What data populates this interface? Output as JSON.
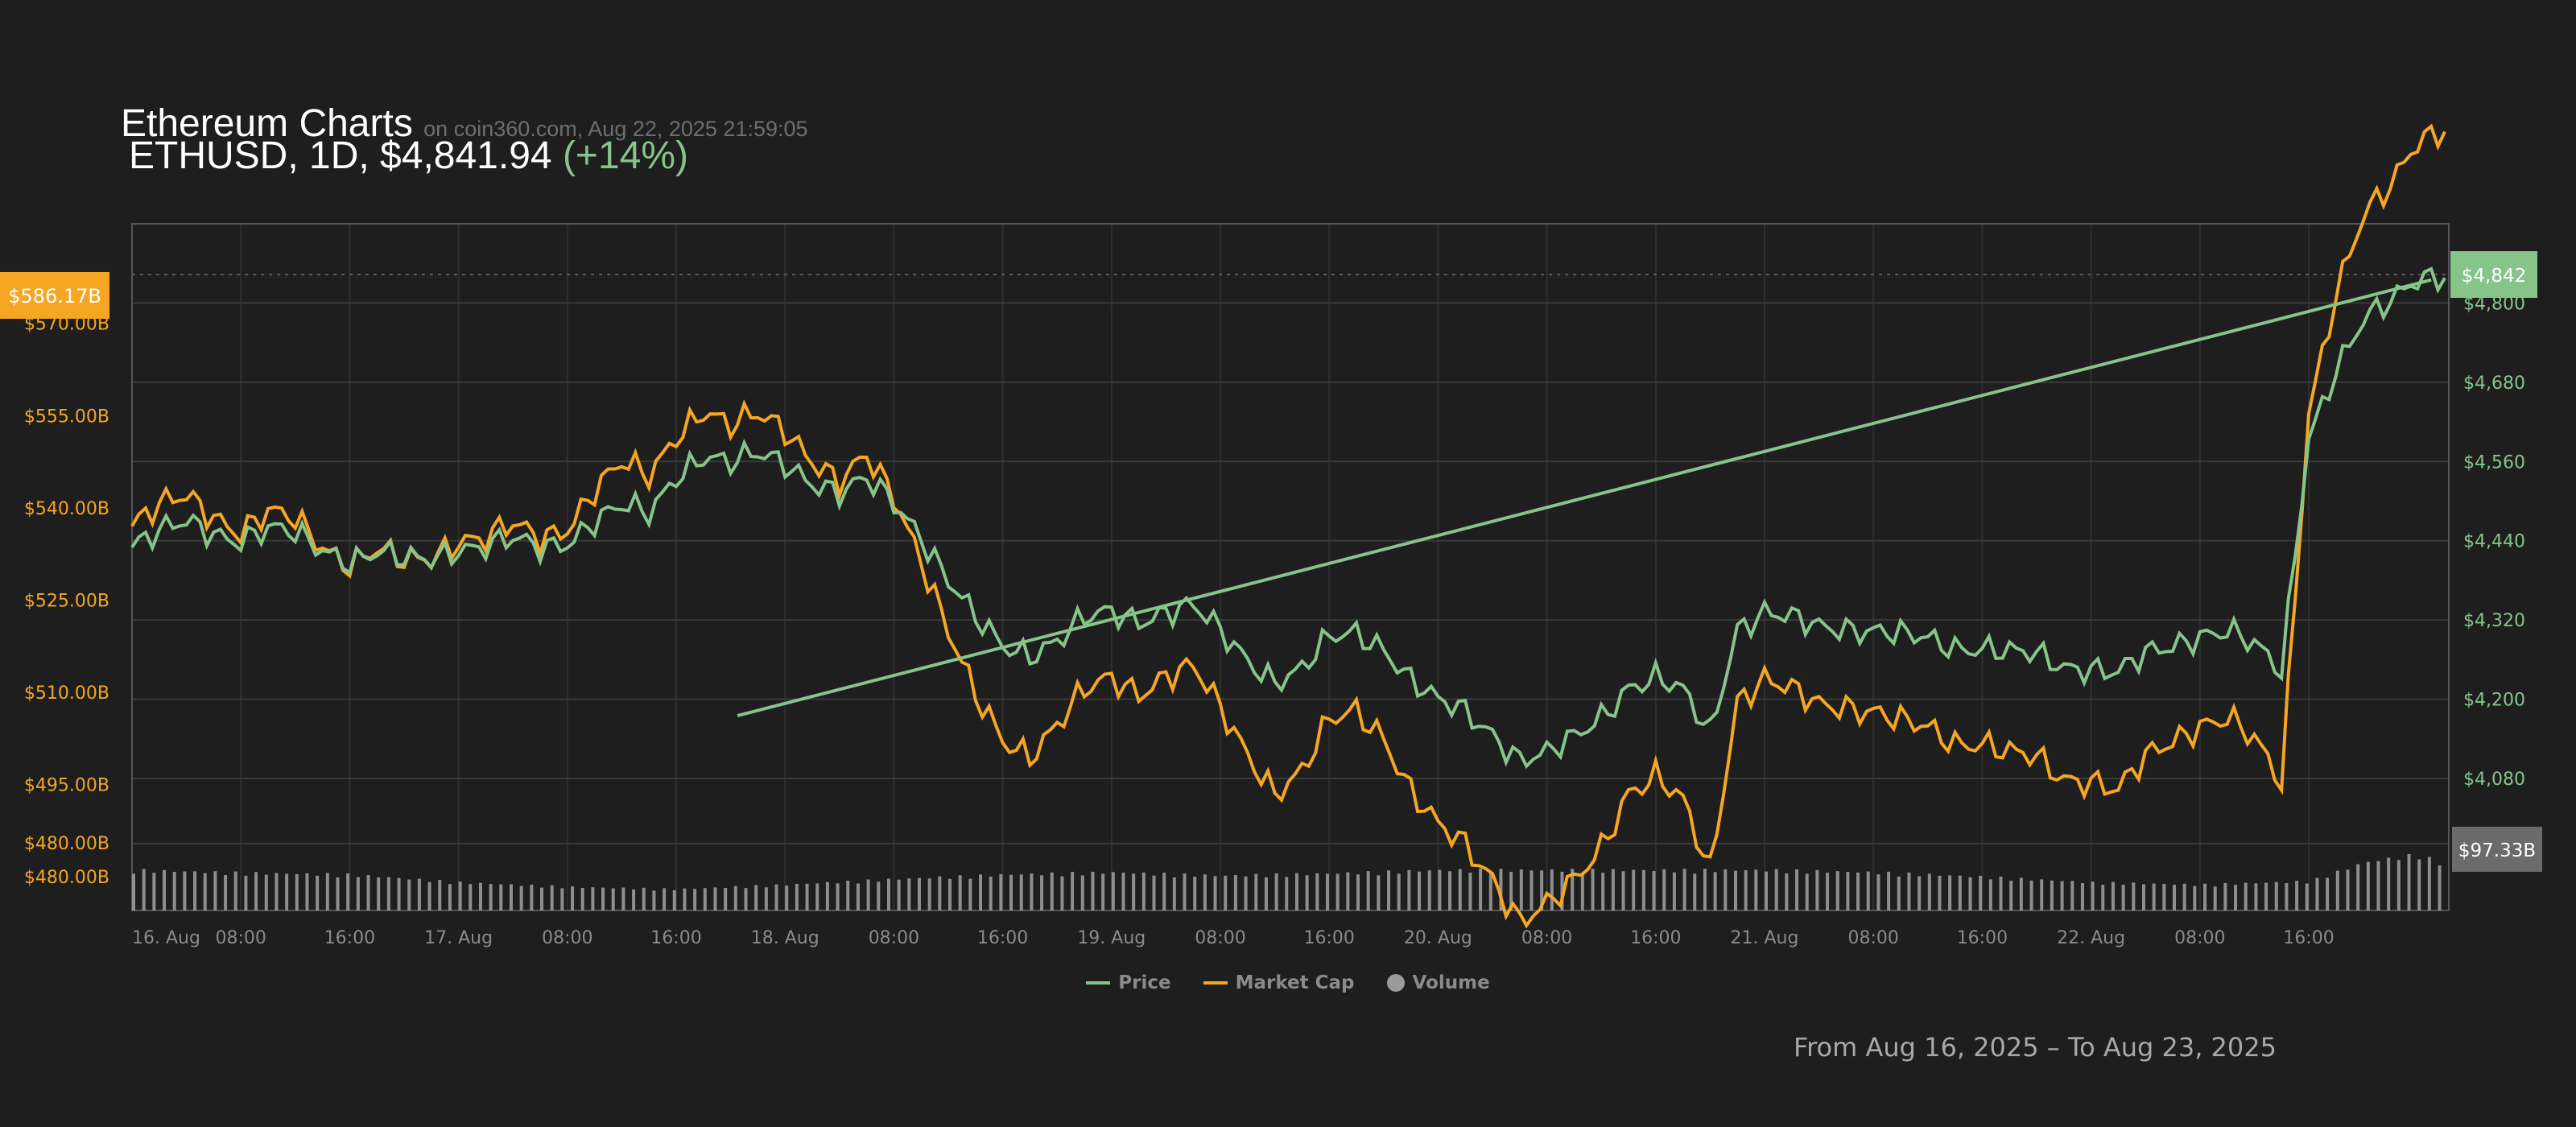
{
  "header": {
    "title": "Ethereum Charts",
    "source": "on coin360.com, Aug 22, 2025 21:59:05",
    "pair_line": "ETHUSD, 1D, $4,841.94",
    "change": "(+14%)"
  },
  "footer": {
    "range": "From Aug 16, 2025 – To Aug 23, 2025"
  },
  "colors": {
    "price": "#86c48a",
    "market_cap": "#f5a623",
    "volume": "#9a9a9a",
    "badge_volume": "#6b6b6b"
  },
  "chart_data": {
    "type": "line",
    "x_ticks": [
      "16. Aug",
      "08:00",
      "16:00",
      "17. Aug",
      "08:00",
      "16:00",
      "18. Aug",
      "08:00",
      "16:00",
      "19. Aug",
      "08:00",
      "16:00",
      "20. Aug",
      "08:00",
      "16:00",
      "21. Aug",
      "08:00",
      "16:00",
      "22. Aug",
      "08:00",
      "16:00"
    ],
    "y_left_ticks": [
      "$480.00B",
      "$495.00B",
      "$510.00B",
      "$525.00B",
      "$540.00B",
      "$555.00B",
      "$570.00B"
    ],
    "y_right_ticks": [
      "$4,080",
      "$4,200",
      "$4,320",
      "$4,440",
      "$4,560",
      "$4,680",
      "$4,800"
    ],
    "y_right_range": [
      3880,
      4920
    ],
    "y_left_range": [
      474.5,
      586.2
    ],
    "badges": {
      "market_cap": "$586.17B",
      "price": "$4,842",
      "volume": "$97.33B"
    },
    "legend": [
      "Price",
      "Market Cap",
      "Volume"
    ],
    "price_series": {
      "name": "Price",
      "x_hours": [
        0,
        2,
        4,
        6,
        8,
        10,
        12,
        14,
        16,
        18,
        20,
        22,
        24,
        26,
        28,
        30,
        32,
        34,
        36,
        38,
        40,
        42,
        44,
        46,
        48,
        50,
        52,
        54,
        56,
        58,
        60,
        62,
        64,
        66,
        68,
        70,
        72,
        74,
        76,
        78,
        80,
        82,
        84,
        86,
        88,
        90,
        92,
        94,
        96,
        98,
        100,
        102,
        104,
        106,
        108,
        110,
        112,
        114,
        116,
        118,
        120,
        122,
        124,
        126,
        128,
        130,
        132,
        134,
        136,
        138,
        140,
        142,
        144,
        146,
        148,
        150,
        152,
        154,
        156,
        158,
        160,
        162,
        164,
        166,
        168,
        170
      ],
      "y": [
        4430,
        4450,
        4470,
        4455,
        4440,
        4455,
        4450,
        4430,
        4410,
        4420,
        4410,
        4415,
        4430,
        4430,
        4440,
        4430,
        4440,
        4470,
        4490,
        4480,
        4540,
        4570,
        4555,
        4570,
        4560,
        4530,
        4510,
        4530,
        4500,
        4450,
        4380,
        4320,
        4280,
        4270,
        4290,
        4320,
        4330,
        4320,
        4335,
        4340,
        4300,
        4260,
        4230,
        4245,
        4290,
        4300,
        4280,
        4230,
        4195,
        4180,
        4150,
        4110,
        4115,
        4140,
        4175,
        4220,
        4230,
        4210,
        4150,
        4310,
        4330,
        4320,
        4310,
        4310,
        4305,
        4295,
        4290,
        4280,
        4280,
        4270,
        4265,
        4250,
        4250,
        4240,
        4265,
        4280,
        4300,
        4305,
        4280,
        4240,
        4600,
        4700,
        4770,
        4800,
        4840,
        4845
      ],
      "trend_line": [
        [
          44.5,
          4175
        ],
        [
          169,
          4835
        ]
      ]
    },
    "market_cap_series": {
      "name": "Market Cap",
      "x_hours": [
        0,
        2,
        4,
        6,
        8,
        10,
        12,
        14,
        16,
        18,
        20,
        22,
        24,
        26,
        28,
        30,
        32,
        34,
        36,
        38,
        40,
        42,
        44,
        46,
        48,
        50,
        52,
        54,
        56,
        58,
        60,
        62,
        64,
        66,
        68,
        70,
        72,
        74,
        76,
        78,
        80,
        82,
        84,
        86,
        88,
        90,
        92,
        94,
        96,
        98,
        100,
        102,
        104,
        106,
        108,
        110,
        112,
        114,
        116,
        118,
        120,
        122,
        124,
        126,
        128,
        130,
        132,
        134,
        136,
        138,
        140,
        142,
        144,
        146,
        148,
        150,
        152,
        154,
        156,
        158,
        160,
        162,
        164,
        166,
        168,
        170
      ],
      "y": [
        537,
        540,
        542,
        539,
        536,
        539,
        538,
        534,
        531,
        533,
        531,
        532,
        535,
        535,
        537,
        535,
        537,
        543,
        547,
        545,
        552,
        556,
        553,
        555,
        553,
        548,
        544,
        548,
        542,
        532,
        520,
        509,
        502,
        500,
        505,
        510,
        512,
        510,
        513,
        514,
        507,
        500,
        494,
        497,
        505,
        507,
        503,
        494,
        488,
        485,
        480,
        473,
        475,
        479,
        485,
        494,
        496,
        492,
        481,
        509,
        512,
        510,
        508,
        508,
        507,
        505,
        504,
        502,
        502,
        500,
        499,
        496,
        496,
        494,
        499,
        502,
        505,
        506,
        502,
        495,
        556,
        575,
        587,
        592,
        600,
        602
      ]
    },
    "volume_series": {
      "name": "Volume",
      "note_units": "relative bar height (0-1)",
      "x_hours": [
        0,
        8,
        16,
        24,
        32,
        40,
        48,
        56,
        64,
        72,
        80,
        88,
        96,
        104,
        112,
        120,
        128,
        136,
        144,
        152,
        160,
        164,
        168,
        170
      ],
      "y": [
        0.72,
        0.67,
        0.64,
        0.5,
        0.42,
        0.38,
        0.46,
        0.56,
        0.64,
        0.68,
        0.62,
        0.66,
        0.72,
        0.72,
        0.72,
        0.72,
        0.68,
        0.6,
        0.5,
        0.46,
        0.52,
        0.86,
        1.0,
        0.8
      ]
    }
  }
}
